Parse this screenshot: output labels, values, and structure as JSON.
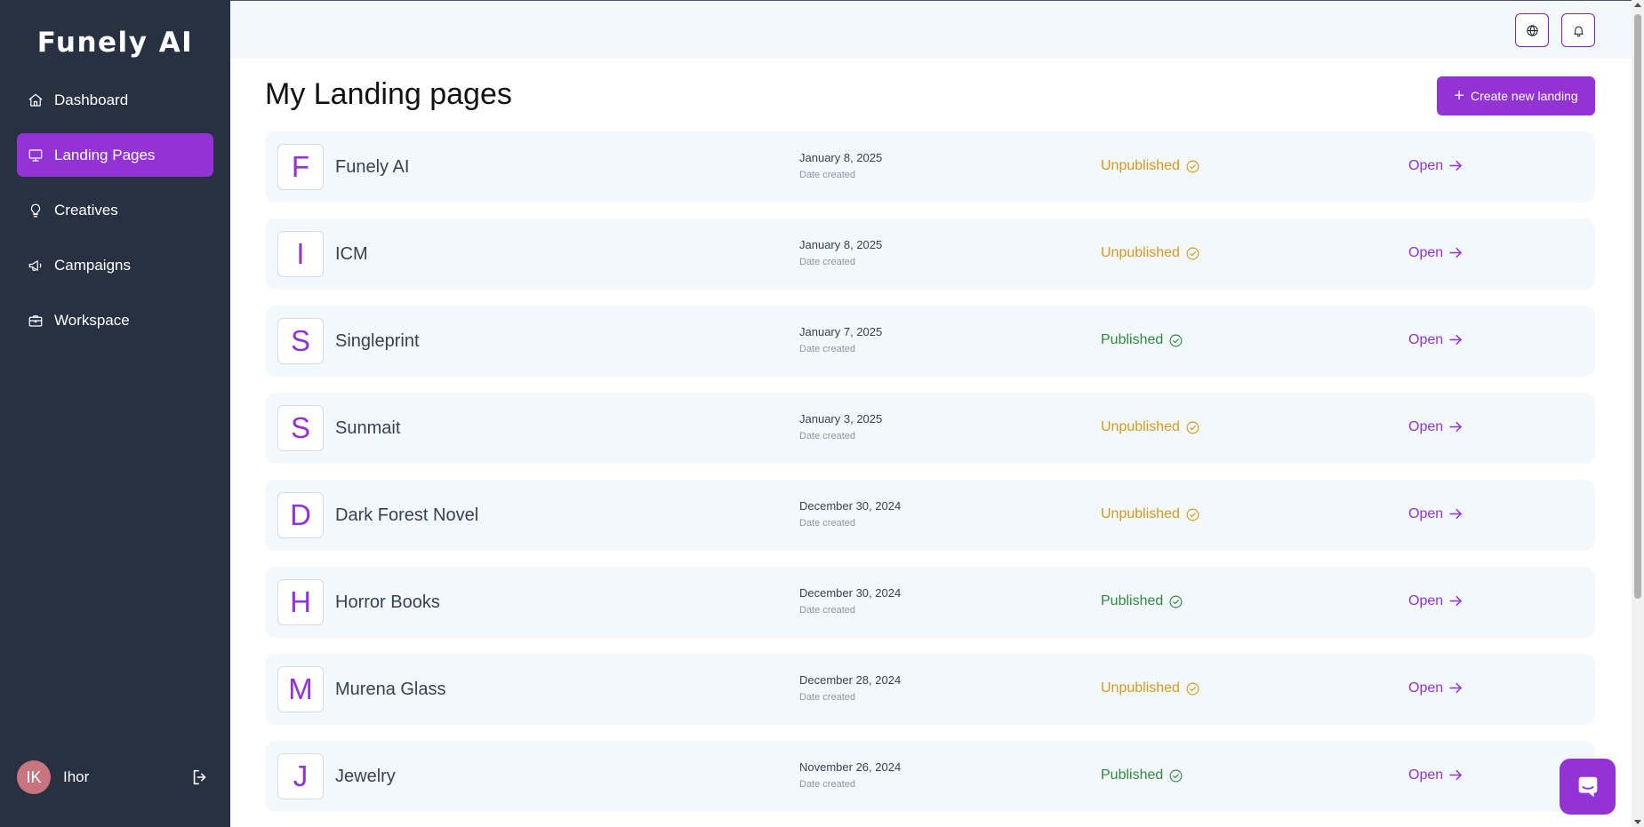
{
  "app": {
    "logo": "Funely AI"
  },
  "sidebar": {
    "items": [
      {
        "label": "Dashboard",
        "icon": "home-icon",
        "active": false
      },
      {
        "label": "Landing Pages",
        "icon": "monitor-icon",
        "active": true
      },
      {
        "label": "Creatives",
        "icon": "lightbulb-icon",
        "active": false
      },
      {
        "label": "Campaigns",
        "icon": "megaphone-icon",
        "active": false
      },
      {
        "label": "Workspace",
        "icon": "briefcase-icon",
        "active": false
      }
    ],
    "user": {
      "initials": "IK",
      "name": "Ihor",
      "logout_icon": "logout-icon"
    }
  },
  "topbar": {
    "globe_icon": "globe-icon",
    "bell_icon": "bell-icon"
  },
  "main": {
    "title": "My Landing pages",
    "create_button": "Create new landing",
    "rows": [
      {
        "letter": "F",
        "name": "Funely AI",
        "date": "January 8, 2025",
        "date_label": "Date created",
        "status": "Unpublished",
        "open": "Open"
      },
      {
        "letter": "I",
        "name": "ICM",
        "date": "January 8, 2025",
        "date_label": "Date created",
        "status": "Unpublished",
        "open": "Open"
      },
      {
        "letter": "S",
        "name": "Singleprint",
        "date": "January 7, 2025",
        "date_label": "Date created",
        "status": "Published",
        "open": "Open"
      },
      {
        "letter": "S",
        "name": "Sunmait",
        "date": "January 3, 2025",
        "date_label": "Date created",
        "status": "Unpublished",
        "open": "Open"
      },
      {
        "letter": "D",
        "name": "Dark Forest Novel",
        "date": "December 30, 2024",
        "date_label": "Date created",
        "status": "Unpublished",
        "open": "Open"
      },
      {
        "letter": "H",
        "name": "Horror Books",
        "date": "December 30, 2024",
        "date_label": "Date created",
        "status": "Published",
        "open": "Open"
      },
      {
        "letter": "M",
        "name": "Murena Glass",
        "date": "December 28, 2024",
        "date_label": "Date created",
        "status": "Unpublished",
        "open": "Open"
      },
      {
        "letter": "J",
        "name": "Jewelry",
        "date": "November 26, 2024",
        "date_label": "Date created",
        "status": "Published",
        "open": "Open"
      }
    ]
  },
  "colors": {
    "accent": "#9333d6",
    "sidebar_bg": "#283142",
    "unpublished": "#d29a1c",
    "published": "#2f8a3e",
    "row_bg": "#f3f8fc"
  }
}
